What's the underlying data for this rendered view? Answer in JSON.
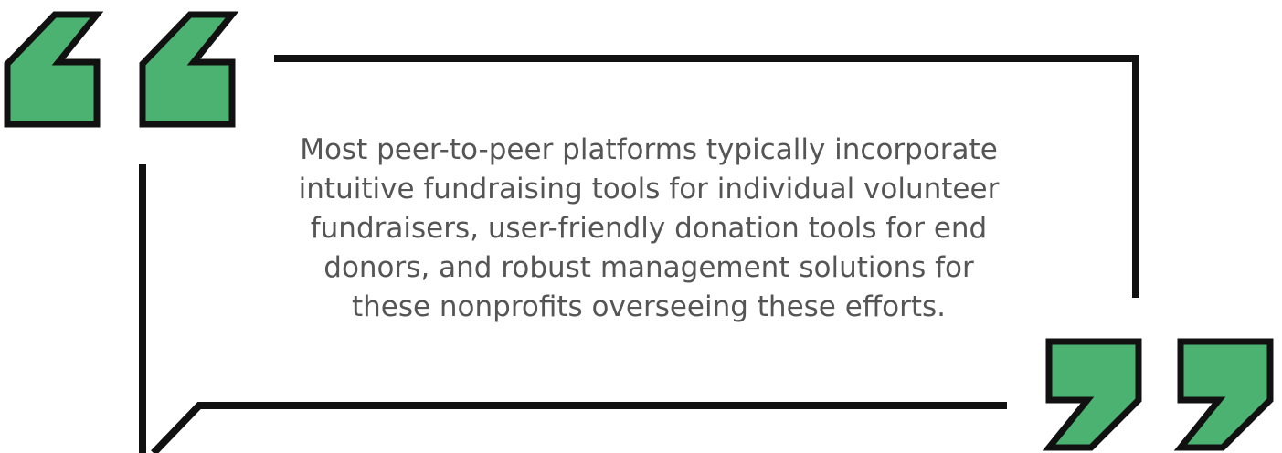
{
  "quote": {
    "lines": [
      "Most peer-to-peer platforms typically incorporate",
      "intuitive fundraising tools for individual volunteer",
      "fundraisers, user-friendly donation tools for end",
      "donors, and robust management solutions for",
      "these nonprofits overseeing these efforts."
    ]
  },
  "colors": {
    "quote_mark_fill": "#4bb271",
    "outline": "#111111",
    "text": "#555555",
    "background": "#ffffff"
  },
  "icons": {
    "open_quote": "opening-double-quote-icon",
    "close_quote": "closing-double-quote-icon"
  }
}
